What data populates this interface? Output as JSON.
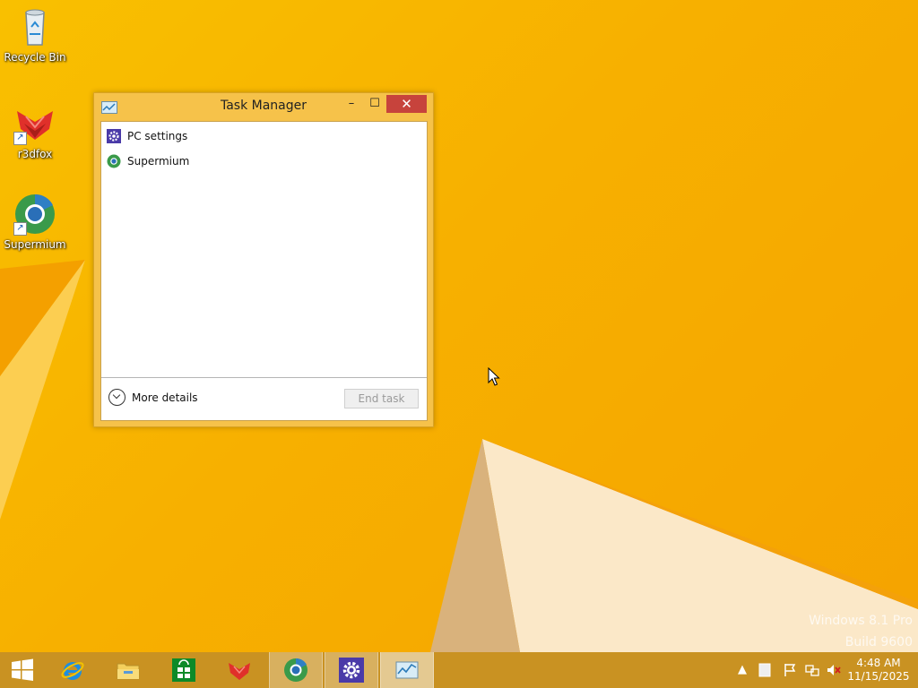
{
  "desktop": {
    "icons": [
      {
        "label": "Recycle Bin",
        "icon": "recycle-bin-icon"
      },
      {
        "label": "r3dfox",
        "icon": "r3dfox-icon"
      },
      {
        "label": "Supermium",
        "icon": "supermium-icon"
      }
    ],
    "watermark": {
      "line1": "Windows 8.1 Pro",
      "line2": "Build 9600"
    }
  },
  "task_manager": {
    "title": "Task Manager",
    "buttons": {
      "minimize": "–",
      "maximize": "☐",
      "close": "✕"
    },
    "processes": [
      {
        "name": "PC settings",
        "icon": "pc-settings-icon"
      },
      {
        "name": "Supermium",
        "icon": "supermium-icon"
      }
    ],
    "more_details": "More details",
    "end_task": "End task"
  },
  "taskbar": {
    "items": [
      {
        "name": "start",
        "icon": "windows-start-icon"
      },
      {
        "name": "internet-explorer",
        "icon": "internet-explorer-icon"
      },
      {
        "name": "file-explorer",
        "icon": "file-explorer-icon"
      },
      {
        "name": "store",
        "icon": "store-icon"
      },
      {
        "name": "r3dfox",
        "icon": "r3dfox-icon"
      },
      {
        "name": "supermium",
        "icon": "supermium-icon"
      },
      {
        "name": "pc-settings",
        "icon": "gear-icon"
      },
      {
        "name": "task-manager",
        "icon": "task-manager-icon"
      }
    ],
    "clock": {
      "time": "4:48 AM",
      "date": "11/15/2025"
    }
  },
  "colors": {
    "wallpaper": "#f8b400",
    "taskbar": "#c99222",
    "window_frame": "#f6c24a",
    "close_button": "#c7433c"
  }
}
